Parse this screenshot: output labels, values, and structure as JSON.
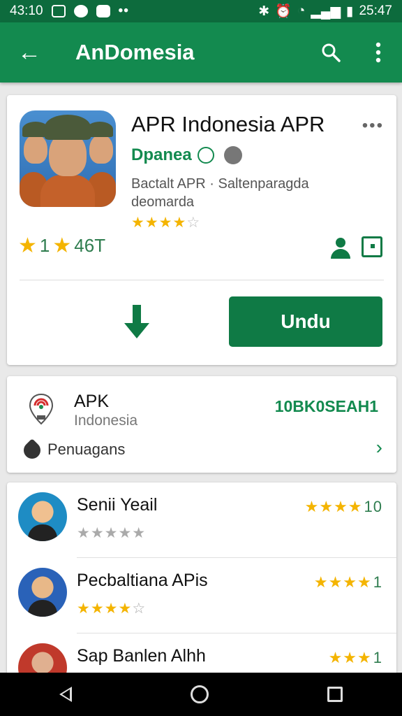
{
  "status": {
    "time_left": "43:10",
    "time_right": "25:47",
    "dots": "••"
  },
  "appbar": {
    "title": "AnDomesia"
  },
  "app": {
    "title": "APR Indonesia APR",
    "developer": "Dpanea",
    "desc_line1": "Bactalt APR · Saltenparagda",
    "desc_line2": "deomarda",
    "stars_small": "★★★★",
    "stars_small_off": "☆",
    "rating_value": "1",
    "rating_count": "46T",
    "install_label": "Undu"
  },
  "info": {
    "title": "APK",
    "subtitle": "Indonesia",
    "code": "10BK0SEAH1",
    "tag_label": "Penuagans"
  },
  "list": [
    {
      "name": "Senii Yeail",
      "sub_on": "",
      "sub_off": "★★★★★",
      "right_stars": "★★★★",
      "right_count": "10"
    },
    {
      "name": "Pecbaltiana APis",
      "sub_on": "★★★★",
      "sub_off": "☆",
      "right_stars": "★★★★",
      "right_count": "1"
    },
    {
      "name": "Sap Banlen Alhh",
      "sub_on": "",
      "sub_off": "",
      "right_stars": "★★★",
      "right_count": "1"
    }
  ],
  "colors": {
    "primary": "#138a4f",
    "primary_dark": "#0d6b3d",
    "star": "#f4b400"
  }
}
